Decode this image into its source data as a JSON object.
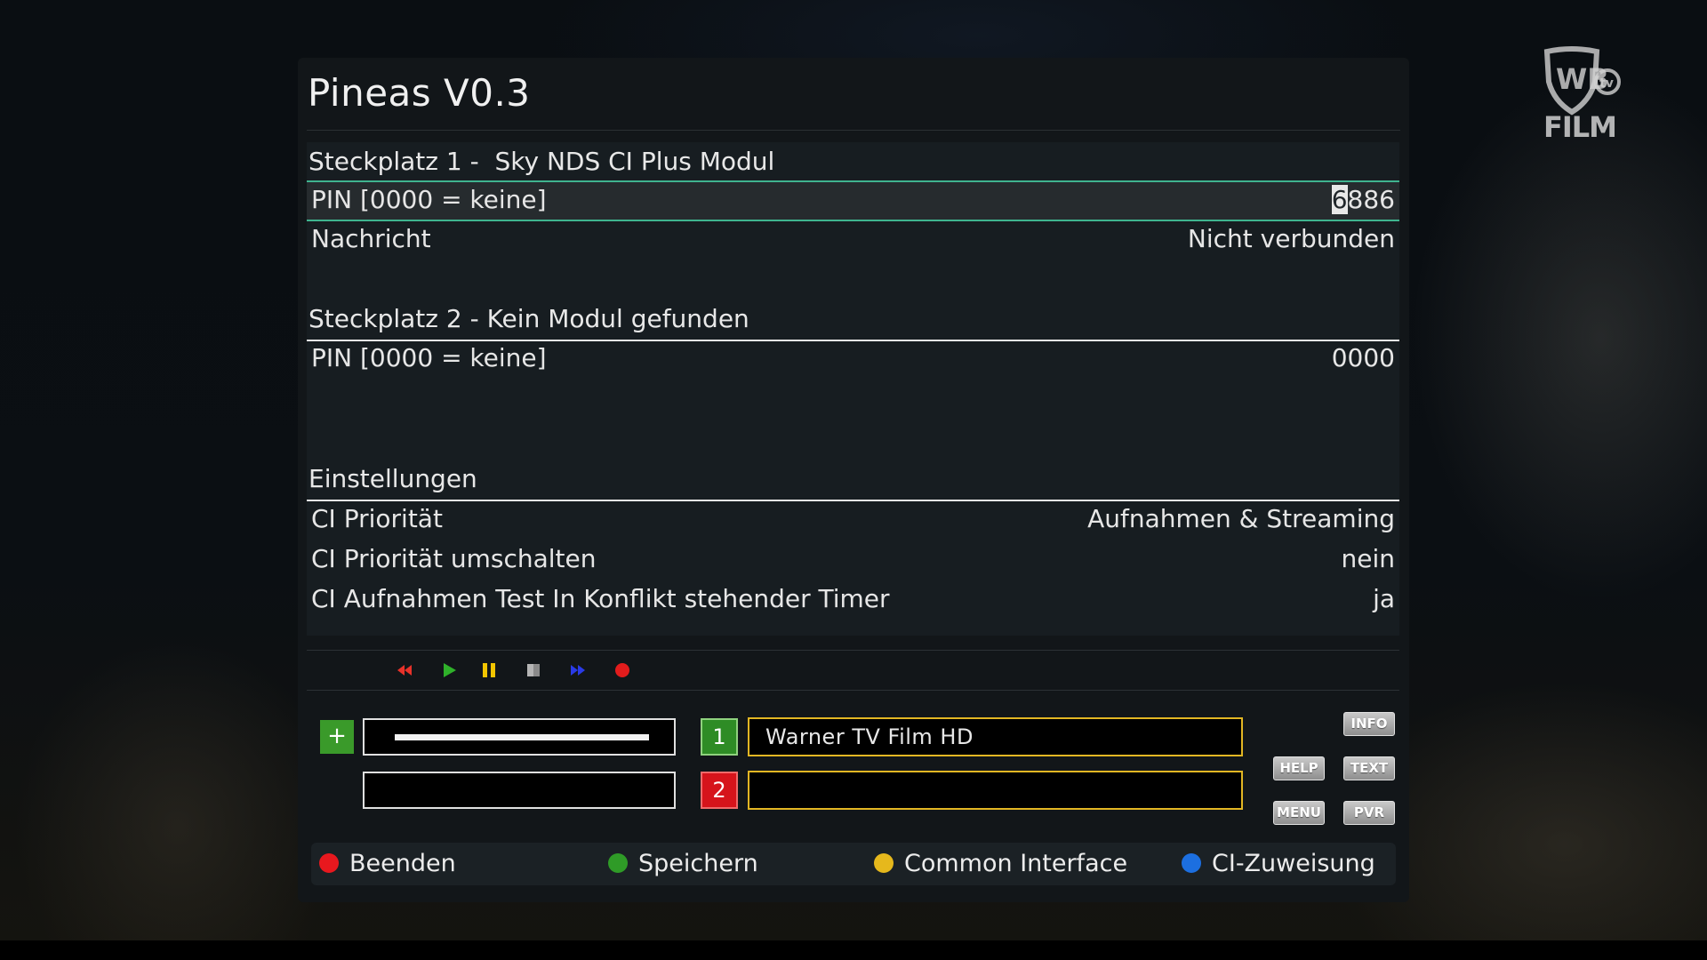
{
  "title": "Pineas V0.3",
  "slot1": {
    "header": "Steckplatz 1 -  Sky NDS CI Plus Modul",
    "rows": [
      {
        "label": "PIN [0000 = keine]",
        "value_cursor": "6",
        "value_rest": "886"
      },
      {
        "label": "Nachricht",
        "value": "Nicht verbunden"
      }
    ]
  },
  "slot2": {
    "header": "Steckplatz 2 - Kein Modul gefunden",
    "rows": [
      {
        "label": "PIN [0000 = keine]",
        "value": "0000"
      }
    ]
  },
  "settings": {
    "header": "Einstellungen",
    "rows": [
      {
        "label": "CI Priorität",
        "value": "Aufnahmen & Streaming"
      },
      {
        "label": "CI Priorität umschalten",
        "value": "nein"
      },
      {
        "label": "CI Aufnahmen Test In Konflikt stehender Timer",
        "value": "ja"
      }
    ]
  },
  "transport": {
    "icons": [
      "rewind-icon",
      "play-icon",
      "pause-icon",
      "stop-icon",
      "fast-forward-icon",
      "record-icon"
    ],
    "colors": {
      "rewind": "#e8322a",
      "play": "#2fb12a",
      "pause": "#f2c500",
      "stop": "#9a9a9a",
      "ffwd": "#2a3be8",
      "record": "#e21c1c"
    }
  },
  "tuners": {
    "plus_label": "+",
    "tuner1": {
      "badge": "1",
      "channel": "Warner TV Film HD",
      "signal_level": 1.0
    },
    "tuner2": {
      "badge": "2",
      "channel": ""
    }
  },
  "remote_keys": {
    "info": "INFO",
    "help": "HELP",
    "text": "TEXT",
    "menu": "MENU",
    "pvr": "PVR"
  },
  "color_buttons": [
    {
      "label": "Beenden",
      "color": "#e8181e"
    },
    {
      "label": "Speichern",
      "color": "#2f9b27"
    },
    {
      "label": "Common Interface",
      "color": "#e6b81c"
    },
    {
      "label": "CI-Zuweisung",
      "color": "#1c6fe0"
    }
  ],
  "channel_logo": {
    "text": "FILM",
    "icon": "wb-tv-logo-icon"
  }
}
